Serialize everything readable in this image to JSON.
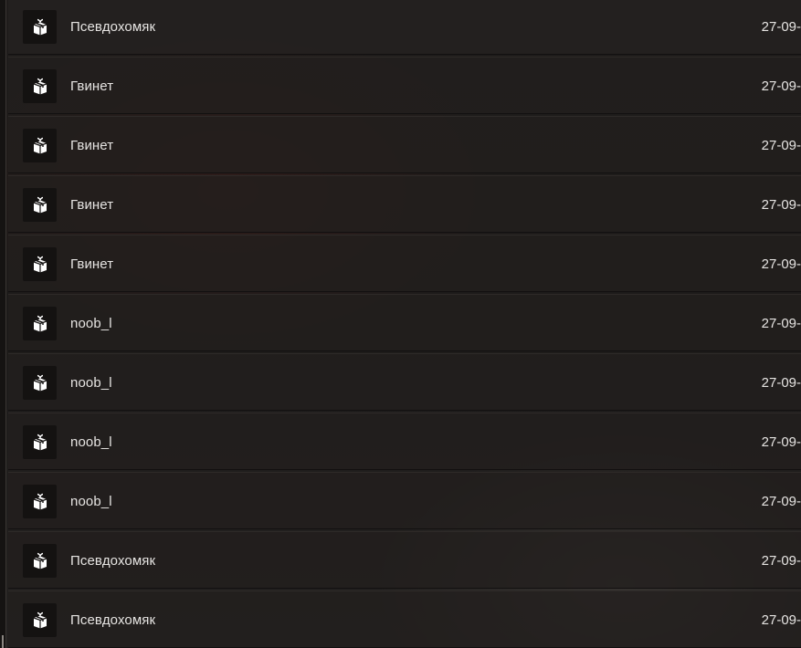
{
  "rows": [
    {
      "icon": "gift-box-icon",
      "name": "Псевдохомяк",
      "date": "27-09-"
    },
    {
      "icon": "gift-box-icon",
      "name": "Гвинет",
      "date": "27-09-"
    },
    {
      "icon": "gift-box-icon",
      "name": "Гвинет",
      "date": "27-09-"
    },
    {
      "icon": "gift-box-icon",
      "name": "Гвинет",
      "date": "27-09-"
    },
    {
      "icon": "gift-box-icon",
      "name": "Гвинет",
      "date": "27-09-"
    },
    {
      "icon": "gift-box-icon",
      "name": "noob_l",
      "date": "27-09-"
    },
    {
      "icon": "gift-box-icon",
      "name": "noob_l",
      "date": "27-09-"
    },
    {
      "icon": "gift-box-icon",
      "name": "noob_l",
      "date": "27-09-"
    },
    {
      "icon": "gift-box-icon",
      "name": "noob_l",
      "date": "27-09-"
    },
    {
      "icon": "gift-box-icon",
      "name": "Псевдохомяк",
      "date": "27-09-"
    },
    {
      "icon": "gift-box-icon",
      "name": "Псевдохомяк",
      "date": "27-09-"
    }
  ],
  "colors": {
    "background": "#1c1a19",
    "row": "#221f1e",
    "icon_box": "#141211",
    "text": "#e6e4e2"
  }
}
